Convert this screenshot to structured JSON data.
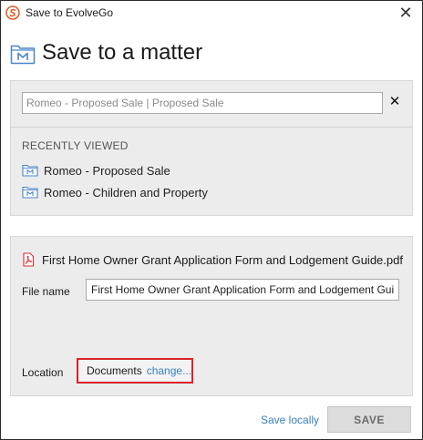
{
  "window": {
    "title": "Save to EvolveGo",
    "close_glyph": "✕"
  },
  "header": {
    "title": "Save to a matter",
    "icon": "matter-folder-icon"
  },
  "search": {
    "value": "Romeo - Proposed Sale | Proposed Sale",
    "clear_glyph": "✕"
  },
  "recent": {
    "label": "RECENTLY VIEWED",
    "items": [
      {
        "label": "Romeo - Proposed Sale",
        "icon": "matter-folder-icon"
      },
      {
        "label": "Romeo - Children and Property",
        "icon": "matter-folder-icon"
      }
    ]
  },
  "file": {
    "name": "First Home Owner Grant Application Form and Lodgement Guide.pdf",
    "icon": "pdf-icon",
    "file_name_label": "File name",
    "file_name_value": "First Home Owner Grant Application Form and Lodgement Guide",
    "location_label": "Location",
    "location_value": "Documents",
    "change_label": "change..."
  },
  "footer": {
    "save_locally_label": "Save locally",
    "save_label": "SAVE"
  },
  "colors": {
    "accent_link": "#3a7fc4",
    "highlight_border": "#d9232a",
    "logo": "#e35c2b",
    "panel_bg": "#ececec",
    "matter_icon": "#4a86c8",
    "pdf_icon": "#d32f2f"
  }
}
